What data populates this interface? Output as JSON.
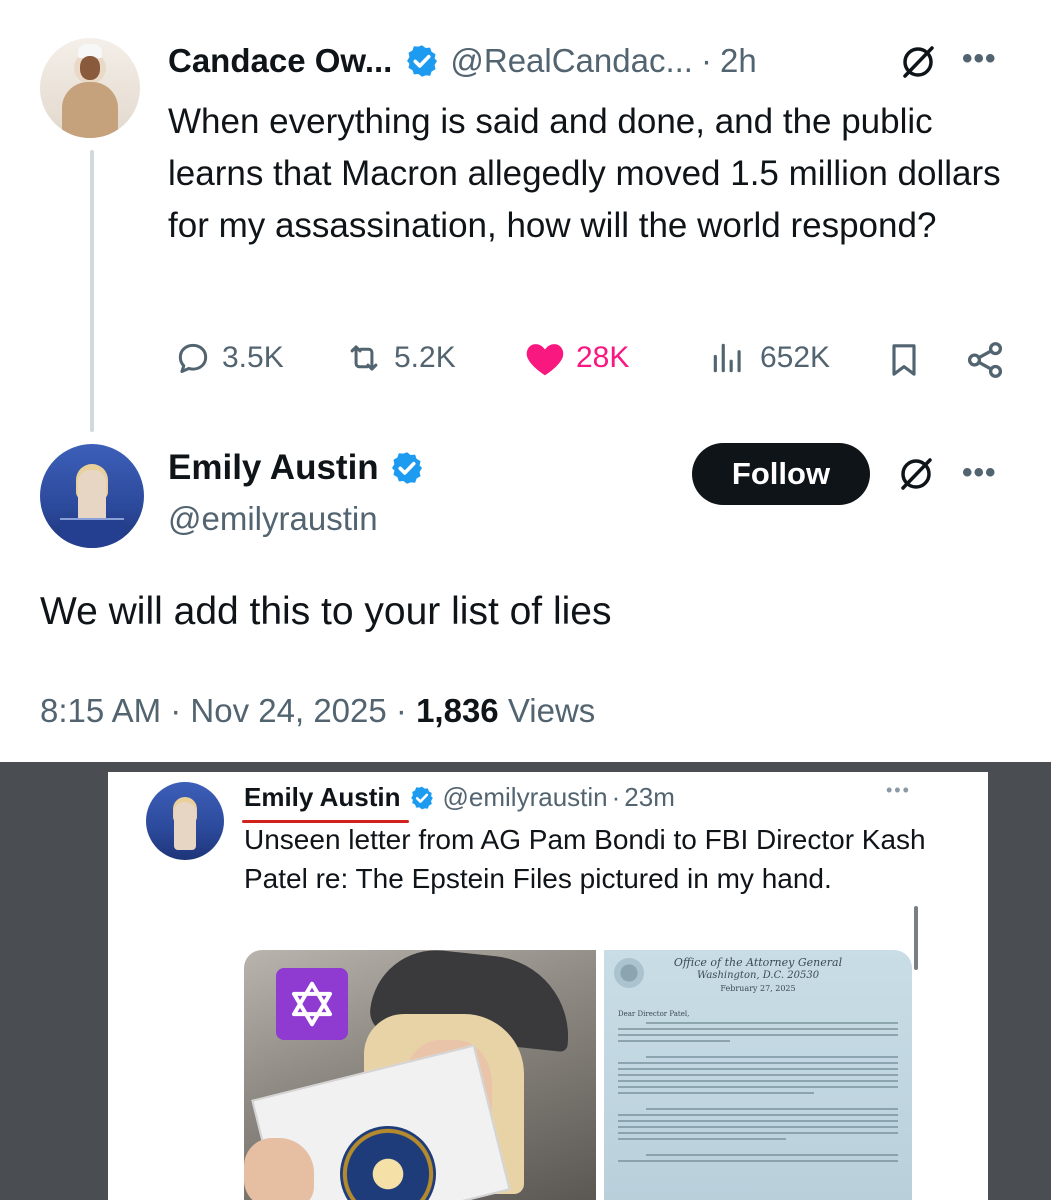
{
  "parent_tweet": {
    "author_name": "Candace Ow...",
    "handle": "@RealCandac...",
    "separator": "·",
    "time": "2h",
    "more": "•••",
    "text": "When everything is said and done, and the public learns that Macron allegedly moved 1.5 million dollars for my assassination, how will the world respond?",
    "stats": {
      "replies": "3.5K",
      "reposts": "5.2K",
      "likes": "28K",
      "views": "652K"
    }
  },
  "main_tweet": {
    "author_name": "Emily Austin",
    "handle": "@emilyraustin",
    "follow_label": "Follow",
    "more": "•••",
    "text": "We will add this to your list of lies",
    "time": "8:15 AM",
    "date": "Nov 24, 2025",
    "views_count": "1,836",
    "views_label": "Views",
    "separator": "·"
  },
  "embedded_screenshot": {
    "author_name": "Emily Austin",
    "handle": "@emilyraustin",
    "separator": "·",
    "time": "23m",
    "more": "•••",
    "text": "Unseen letter from AG Pam Bondi to FBI Director Kash Patel re: The Epstein Files pictured in my hand.",
    "letter": {
      "header_line1": "Office of the Attorney General",
      "header_line2": "Washington, D.C. 20530",
      "date": "February 27, 2025",
      "salutation": "Dear Director Patel,"
    }
  },
  "colors": {
    "verified_blue": "#1d9bf0",
    "like_pink": "#f91880",
    "secondary_text": "#536471",
    "follow_bg": "#0f1419",
    "underline_red": "#d0211c",
    "badge_purple": "#8f3ad1"
  },
  "icons": [
    "verified-badge-icon",
    "grok-icon",
    "more-icon",
    "reply-icon",
    "repost-icon",
    "like-icon",
    "views-icon",
    "bookmark-icon",
    "share-icon",
    "star-of-david-icon"
  ]
}
